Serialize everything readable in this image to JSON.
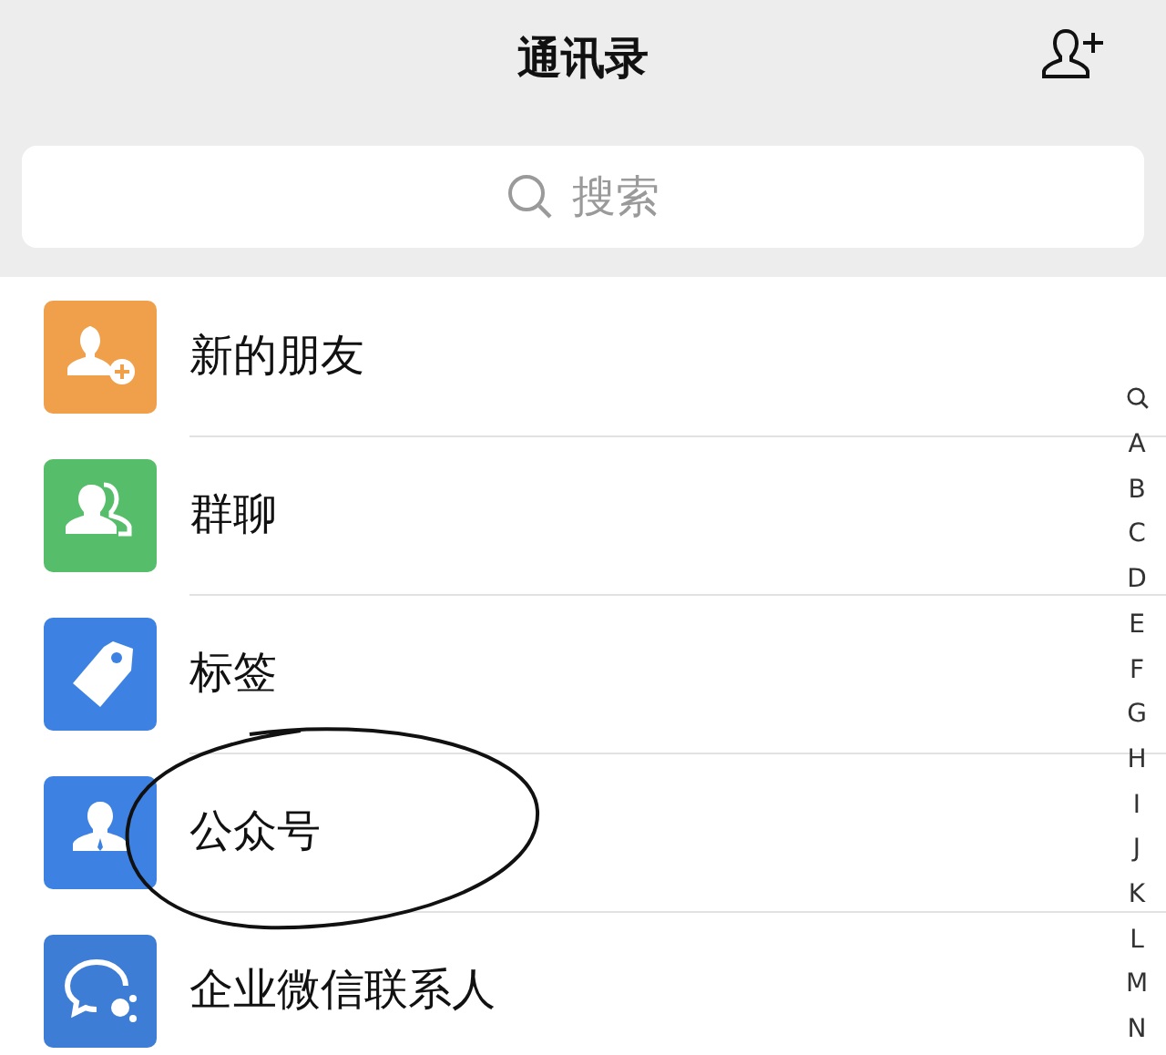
{
  "header": {
    "title": "通讯录"
  },
  "search": {
    "placeholder": "搜索"
  },
  "items": [
    {
      "label": "新的朋友",
      "kind": "new-friend",
      "color": "#f0a04b",
      "circled": false
    },
    {
      "label": "群聊",
      "kind": "group",
      "color": "#56be6a",
      "circled": false
    },
    {
      "label": "标签",
      "kind": "tag",
      "color": "#3d82e3",
      "circled": false
    },
    {
      "label": "公众号",
      "kind": "official",
      "color": "#3d82e3",
      "circled": true
    },
    {
      "label": "企业微信联系人",
      "kind": "enterprise",
      "color": "#3d7dd6",
      "circled": false
    }
  ],
  "index": {
    "letters": [
      "A",
      "B",
      "C",
      "D",
      "E",
      "F",
      "G",
      "H",
      "I",
      "J",
      "K",
      "L",
      "M",
      "N"
    ]
  }
}
